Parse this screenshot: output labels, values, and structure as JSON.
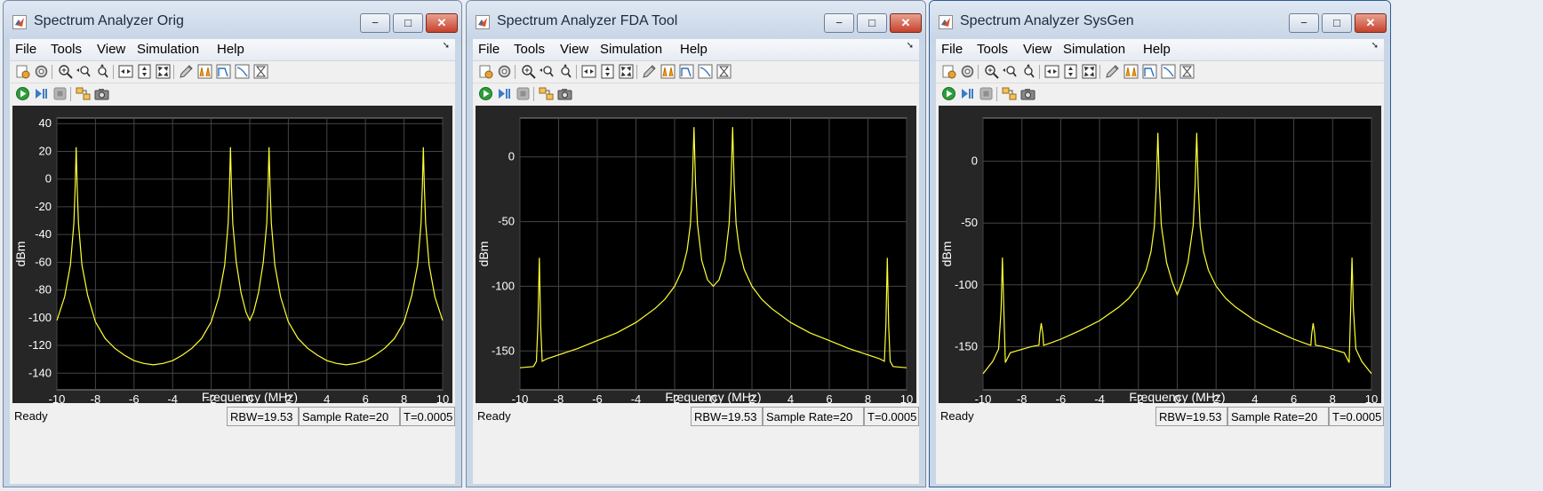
{
  "menu_labels": [
    "File",
    "Tools",
    "View",
    "Simulation",
    "Help"
  ],
  "status": {
    "ready": "Ready",
    "rbw": "RBW=19.53",
    "sample_rate": "Sample Rate=20",
    "time": "T=0.0005"
  },
  "window_buttons": {
    "minimize": "−",
    "maximize": "□",
    "close": "✕"
  },
  "colors": {
    "plot_bg": "#000000",
    "axes_bg": "#262626",
    "trace": "#ffff33",
    "grid": "#444444",
    "tick_text": "#ffffff"
  },
  "toolbar_icons": [
    "config-properties-icon",
    "settings-icon",
    "zoom-in-icon",
    "zoom-x-icon",
    "zoom-y-icon",
    "scale-x-icon",
    "scale-y-icon",
    "scale-xy-icon",
    "style-icon",
    "spectrum-icon",
    "filter-icon",
    "trace-icon",
    "measure-icon"
  ],
  "sim_icons": [
    "run-icon",
    "step-forward-icon",
    "stop-icon",
    "highlight-block-icon",
    "snapshot-icon"
  ],
  "windows": [
    {
      "title": "Spectrum Analyzer Orig",
      "active": false,
      "chart_data": {
        "type": "line",
        "xlabel": "Frequency (MHz)",
        "ylabel": "dBm",
        "xlim": [
          -10,
          10
        ],
        "ylim": [
          -152,
          44
        ],
        "yticks": [
          40,
          20,
          0,
          -20,
          -40,
          -60,
          -80,
          -100,
          -120,
          -140
        ],
        "xticks": [
          -10,
          -8,
          -6,
          -4,
          -2,
          0,
          2,
          4,
          6,
          8,
          10
        ],
        "grid": true,
        "series": [
          {
            "x": [
              -10,
              -9.6,
              -9.3,
              -9.12,
              -9.05,
              -9.0,
              -8.95,
              -8.88,
              -8.7,
              -8.4,
              -8.0,
              -7.5,
              -7.0,
              -6.5,
              -6.0,
              -5.5,
              -5.0,
              -4.5,
              -4.0,
              -3.5,
              -3.0,
              -2.5,
              -2.0,
              -1.6,
              -1.3,
              -1.12,
              -1.05,
              -1.0,
              -0.95,
              -0.88,
              -0.7,
              -0.45,
              -0.2,
              0.0,
              0.2,
              0.45,
              0.7,
              0.88,
              0.95,
              1.0,
              1.05,
              1.12,
              1.3,
              1.6,
              2.0,
              2.5,
              3.0,
              3.5,
              4.0,
              4.5,
              5.0,
              5.5,
              6.0,
              6.5,
              7.0,
              7.5,
              8.0,
              8.4,
              8.7,
              8.88,
              8.95,
              9.0,
              9.05,
              9.12,
              9.3,
              9.6,
              10
            ],
            "y": [
              -102,
              -85,
              -62,
              -32,
              -5,
              23,
              -5,
              -32,
              -62,
              -84,
              -103,
              -115,
              -122,
              -127,
              -131,
              -133,
              -134,
              -133,
              -131,
              -127,
              -122,
              -115,
              -103,
              -85,
              -62,
              -32,
              -5,
              23,
              -5,
              -32,
              -60,
              -82,
              -96,
              -102,
              -96,
              -82,
              -60,
              -32,
              -5,
              23,
              -5,
              -32,
              -62,
              -85,
              -103,
              -115,
              -122,
              -127,
              -131,
              -133,
              -134,
              -133,
              -131,
              -127,
              -122,
              -115,
              -103,
              -84,
              -62,
              -32,
              -5,
              23,
              -5,
              -32,
              -62,
              -85,
              -102
            ]
          }
        ]
      }
    },
    {
      "title": "Spectrum Analyzer FDA Tool",
      "active": false,
      "chart_data": {
        "type": "line",
        "xlabel": "Frequency (MHz)",
        "ylabel": "dBm",
        "xlim": [
          -10,
          10
        ],
        "ylim": [
          -180,
          30
        ],
        "yticks": [
          0,
          -50,
          -100,
          -150
        ],
        "xticks": [
          -10,
          -8,
          -6,
          -4,
          -2,
          0,
          2,
          4,
          6,
          8,
          10
        ],
        "grid": true,
        "series": [
          {
            "x": [
              -10,
              -9.3,
              -9.15,
              -9.07,
              -9.0,
              -8.93,
              -8.85,
              -8.6,
              -8.0,
              -7.0,
              -6.0,
              -5.0,
              -4.0,
              -3.0,
              -2.5,
              -2.0,
              -1.6,
              -1.35,
              -1.18,
              -1.08,
              -1.0,
              -0.92,
              -0.82,
              -0.6,
              -0.3,
              0.0,
              0.3,
              0.6,
              0.82,
              0.92,
              1.0,
              1.08,
              1.18,
              1.35,
              1.6,
              2.0,
              2.5,
              3.0,
              4.0,
              5.0,
              6.0,
              7.0,
              8.0,
              8.6,
              8.85,
              8.93,
              9.0,
              9.07,
              9.15,
              9.3,
              10
            ],
            "y": [
              -163,
              -162,
              -158,
              -130,
              -78,
              -130,
              -158,
              -156,
              -153,
              -148,
              -142,
              -136,
              -128,
              -117,
              -110,
              -100,
              -87,
              -72,
              -52,
              -20,
              23,
              -20,
              -52,
              -80,
              -95,
              -100,
              -95,
              -80,
              -52,
              -20,
              23,
              -20,
              -52,
              -72,
              -87,
              -100,
              -110,
              -117,
              -128,
              -136,
              -142,
              -148,
              -153,
              -156,
              -158,
              -130,
              -78,
              -130,
              -158,
              -162,
              -163
            ]
          }
        ]
      }
    },
    {
      "title": "Spectrum Analyzer SysGen",
      "active": true,
      "chart_data": {
        "type": "line",
        "xlabel": "Frequency (MHz)",
        "ylabel": "dBm",
        "xlim": [
          -10,
          10
        ],
        "ylim": [
          -185,
          35
        ],
        "yticks": [
          0,
          -50,
          -100,
          -150
        ],
        "xticks": [
          -10,
          -8,
          -6,
          -4,
          -2,
          0,
          2,
          4,
          6,
          8,
          10
        ],
        "grid": true,
        "series": [
          {
            "x": [
              -10,
              -9.5,
              -9.2,
              -9.07,
              -9.0,
              -8.93,
              -8.85,
              -8.6,
              -7.5,
              -7.12,
              -7.08,
              -7.0,
              -6.92,
              -6.88,
              -6.5,
              -6.0,
              -5.0,
              -4.0,
              -3.0,
              -2.5,
              -2.0,
              -1.6,
              -1.35,
              -1.18,
              -1.08,
              -1.0,
              -0.92,
              -0.82,
              -0.55,
              -0.25,
              0.0,
              0.25,
              0.55,
              0.82,
              0.92,
              1.0,
              1.08,
              1.18,
              1.35,
              1.6,
              2.0,
              2.5,
              3.0,
              4.0,
              5.0,
              6.0,
              6.5,
              6.88,
              6.92,
              7.0,
              7.08,
              7.12,
              7.5,
              8.6,
              8.85,
              8.93,
              9.0,
              9.07,
              9.2,
              9.5,
              10
            ],
            "y": [
              -172,
              -162,
              -152,
              -120,
              -78,
              -120,
              -163,
              -155,
              -150,
              -149,
              -140,
              -131,
              -140,
              -149,
              -147,
              -144,
              -137,
              -129,
              -118,
              -111,
              -101,
              -88,
              -73,
              -53,
              -20,
              23,
              -20,
              -52,
              -82,
              -98,
              -108,
              -98,
              -82,
              -52,
              -20,
              23,
              -20,
              -53,
              -73,
              -88,
              -101,
              -111,
              -118,
              -129,
              -137,
              -144,
              -147,
              -149,
              -140,
              -131,
              -140,
              -149,
              -150,
              -155,
              -163,
              -120,
              -78,
              -120,
              -152,
              -162,
              -172
            ]
          }
        ]
      }
    }
  ]
}
